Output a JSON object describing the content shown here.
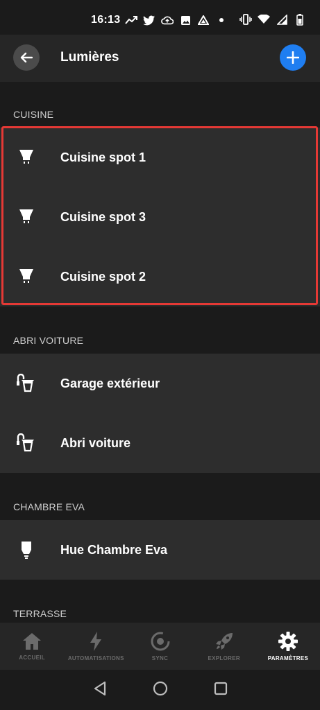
{
  "status_bar": {
    "time": "16:13"
  },
  "app_bar": {
    "title": "Lumières",
    "back_icon": "arrow-left-icon",
    "add_icon": "plus-icon",
    "accent": "#1f7ef1"
  },
  "sections": [
    {
      "title": "CUISINE",
      "items": [
        {
          "label": "Cuisine spot 1",
          "icon": "spot-bulb-icon"
        },
        {
          "label": "Cuisine spot 3",
          "icon": "spot-bulb-icon"
        },
        {
          "label": "Cuisine spot 2",
          "icon": "spot-bulb-icon"
        }
      ]
    },
    {
      "title": "ABRI VOITURE",
      "items": [
        {
          "label": "Garage extérieur",
          "icon": "wall-lamp-icon"
        },
        {
          "label": "Abri voiture",
          "icon": "wall-lamp-icon"
        }
      ]
    },
    {
      "title": "CHAMBRE EVA",
      "items": [
        {
          "label": "Hue Chambre Eva",
          "icon": "bulb-icon"
        }
      ]
    },
    {
      "title": "TERRASSE",
      "items": []
    }
  ],
  "highlight_color": "#e53935",
  "bottom_nav": [
    {
      "label": "ACCUEIL",
      "icon": "home-icon",
      "active": false
    },
    {
      "label": "AUTOMATISATIONS",
      "icon": "bolt-icon",
      "active": false
    },
    {
      "label": "SYNC",
      "icon": "sync-icon",
      "active": false
    },
    {
      "label": "EXPLORER",
      "icon": "rocket-icon",
      "active": false
    },
    {
      "label": "PARAMÈTRES",
      "icon": "gear-icon",
      "active": true
    }
  ]
}
